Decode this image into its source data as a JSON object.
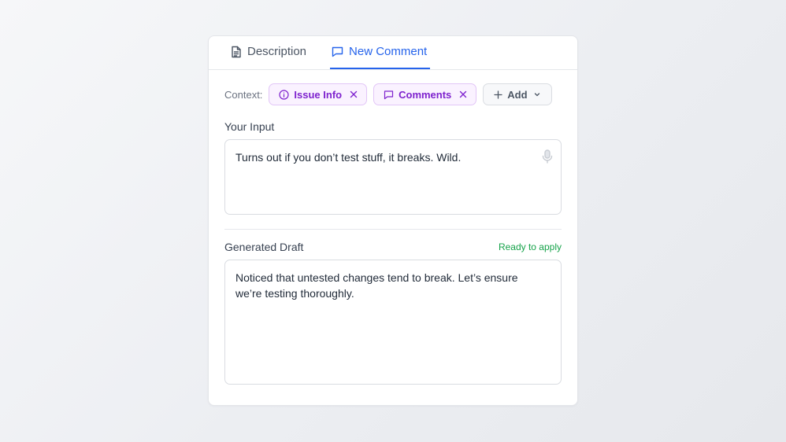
{
  "tabs": [
    {
      "label": "Description",
      "icon": "document-icon",
      "active": false
    },
    {
      "label": "New Comment",
      "icon": "comment-icon",
      "active": true
    }
  ],
  "context": {
    "label": "Context:",
    "chips": [
      {
        "label": "Issue Info",
        "icon": "info-icon"
      },
      {
        "label": "Comments",
        "icon": "comment-icon"
      }
    ],
    "add_label": "Add"
  },
  "input": {
    "label": "Your Input",
    "value": "Turns out if you don’t test stuff, it breaks. Wild."
  },
  "draft": {
    "label": "Generated Draft",
    "status": "Ready to apply",
    "value": "Noticed that untested changes tend to break. Let’s ensure we’re testing thoroughly."
  },
  "colors": {
    "accent": "#2563eb",
    "chip_purple": "#7e22ce",
    "status_green": "#16a34a"
  }
}
